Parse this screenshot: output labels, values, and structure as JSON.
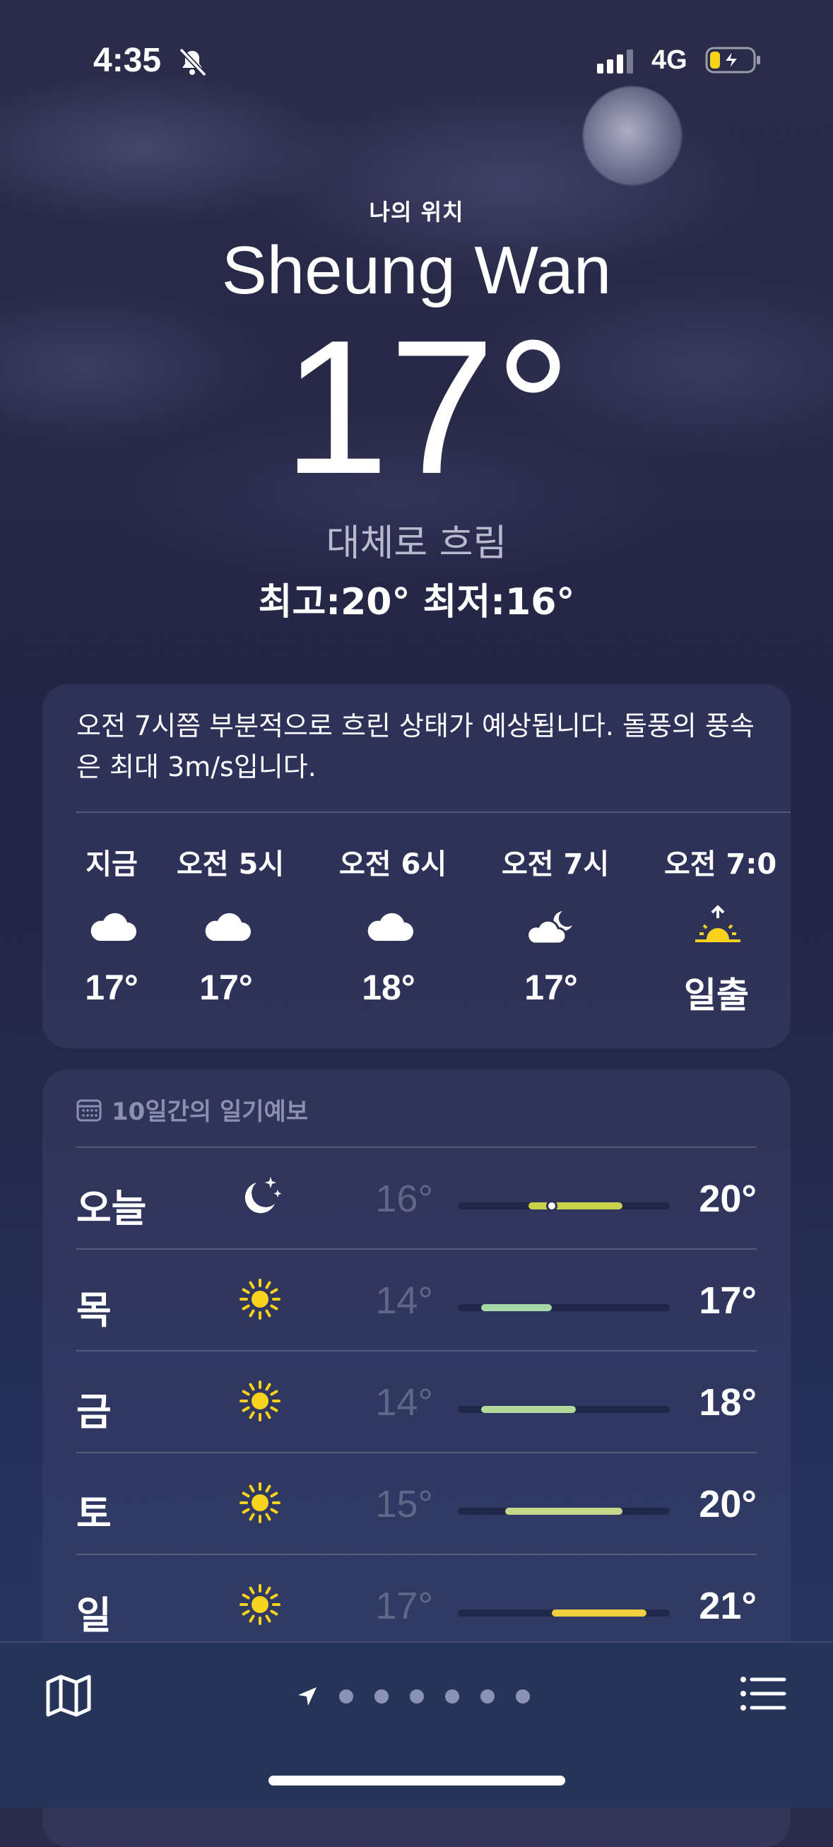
{
  "status_bar": {
    "time": "4:35",
    "network": "4G"
  },
  "header": {
    "location_label": "나의 위치",
    "city": "Sheung Wan",
    "temperature": "17°",
    "condition": "대체로 흐림",
    "high_low": "최고:20°  최저:16°"
  },
  "hourly": {
    "summary": "오전 7시쯤 부분적으로 흐린 상태가 예상됩니다. 돌풍의 풍속은 최대 3m/s입니다.",
    "items": [
      {
        "label": "지금",
        "icon": "cloud-icon",
        "value": "17°"
      },
      {
        "label": "오전 5시",
        "icon": "cloud-icon",
        "value": "17°"
      },
      {
        "label": "오전 6시",
        "icon": "cloud-icon",
        "value": "18°"
      },
      {
        "label": "오전 7시",
        "icon": "cloud-moon-icon",
        "value": "17°"
      },
      {
        "label": "오전 7:0",
        "icon": "sunrise-icon",
        "value": "일출"
      }
    ]
  },
  "daily": {
    "title": "10일간의 일기예보",
    "range": {
      "min": 13,
      "max": 22
    },
    "days": [
      {
        "name": "오늘",
        "icon": "moon-stars-icon",
        "low": "16°",
        "high": "20°",
        "low_val": 16,
        "high_val": 20,
        "current": 17,
        "color": "#c8d24a"
      },
      {
        "name": "목",
        "icon": "sun-icon",
        "low": "14°",
        "high": "17°",
        "low_val": 14,
        "high_val": 17,
        "color": "#a6d9a6"
      },
      {
        "name": "금",
        "icon": "sun-icon",
        "low": "14°",
        "high": "18°",
        "low_val": 14,
        "high_val": 18,
        "color": "#b2d99a"
      },
      {
        "name": "토",
        "icon": "sun-icon",
        "low": "15°",
        "high": "20°",
        "low_val": 15,
        "high_val": 20,
        "color": "#c4d78a"
      },
      {
        "name": "일",
        "icon": "sun-icon",
        "low": "17°",
        "high": "21°",
        "low_val": 17,
        "high_val": 21,
        "color": "#f0d040"
      }
    ]
  },
  "pager": {
    "page_count": 6,
    "current": 0
  },
  "colors": {
    "sun": "#f8d21c",
    "background": "#24284a",
    "tab_bar": "#27345a"
  }
}
